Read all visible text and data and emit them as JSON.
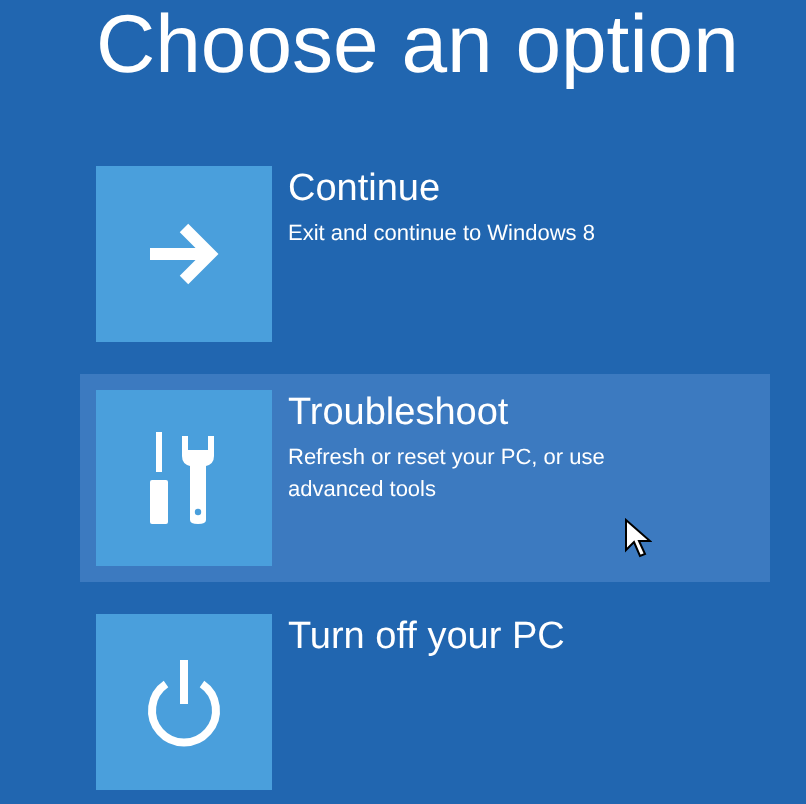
{
  "title": "Choose an option",
  "options": [
    {
      "label": "Continue",
      "description": "Exit and continue to Windows 8",
      "highlighted": false
    },
    {
      "label": "Troubleshoot",
      "description": "Refresh or reset your PC, or use advanced tools",
      "highlighted": true
    },
    {
      "label": "Turn off your PC",
      "highlighted": false
    }
  ]
}
